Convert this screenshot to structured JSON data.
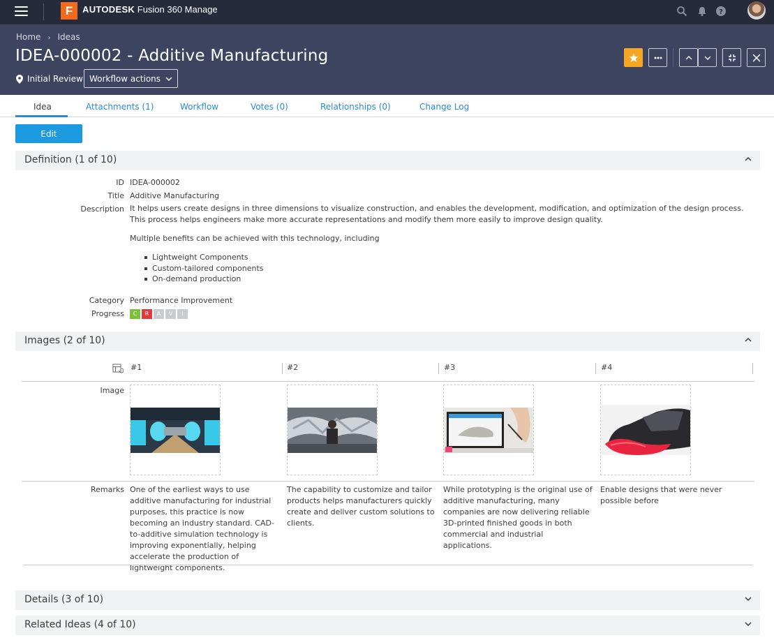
{
  "app": {
    "brand_bold": "AUTODESK",
    "brand_rest": "Fusion 360 Manage",
    "logo_letter": "F"
  },
  "breadcrumb": {
    "home": "Home",
    "current": "Ideas"
  },
  "record": {
    "title": "IDEA-000002 - Additive Manufacturing",
    "state": "Initial Review",
    "workflow_actions": "Workflow actions"
  },
  "tabs": [
    "Idea",
    "Attachments (1)",
    "Workflow",
    "Votes (0)",
    "Relationships (0)",
    "Change Log"
  ],
  "edit_label": "Edit",
  "sections": {
    "definition": "Definition (1 of 10)",
    "images": "Images (2 of 10)",
    "details": "Details (3 of 10)",
    "related": "Related Ideas (4 of 10)"
  },
  "definition": {
    "labels": {
      "id": "ID",
      "title": "Title",
      "description": "Description",
      "category": "Category",
      "progress": "Progress"
    },
    "id": "IDEA-000002",
    "title": "Additive Manufacturing",
    "description_p1": "It helps users create designs in three dimensions to visualize construction, and enables the development, modification, and optimization of the design process. This process helps engineers make more accurate representations and modify them more easily to improve design quality.",
    "description_p2": "Multiple benefits can be achieved with this technology, including",
    "benefits": [
      "Lightweight Components",
      "Custom-tailored components",
      "On-demand production"
    ],
    "category": "Performance Improvement",
    "progress": [
      {
        "letter": "C",
        "color": "#7bbf3d"
      },
      {
        "letter": "R",
        "color": "#e0393e"
      },
      {
        "letter": "A",
        "color": "#c8cbd0"
      },
      {
        "letter": "V",
        "color": "#c8cbd0"
      },
      {
        "letter": "I",
        "color": "#c8cbd0"
      }
    ]
  },
  "images": {
    "row_labels": {
      "image": "Image",
      "remarks": "Remarks"
    },
    "columns": [
      "#1",
      "#2",
      "#3",
      "#4"
    ],
    "remarks": [
      "One of the earliest ways to use additive manufacturing for industrial purposes, this practice is now becoming an industry standard. CAD-to-additive simulation technology is improving exponentially, helping accelerate the production of lightweight components.",
      "The capability to customize and tailor products helps manufacturers quickly create and deliver custom solutions to clients.",
      "While prototyping is the original use of additive manufacturing, many companies are now delivering reliable 3D-printed finished goods in both commercial and industrial applications.",
      "Enable designs that were never possible before"
    ]
  },
  "colors": {
    "topbar": "#262a3a",
    "header": "#3d4460",
    "accent": "#2a8ad8",
    "edit": "#1b9ae0",
    "star": "#f5a623"
  }
}
